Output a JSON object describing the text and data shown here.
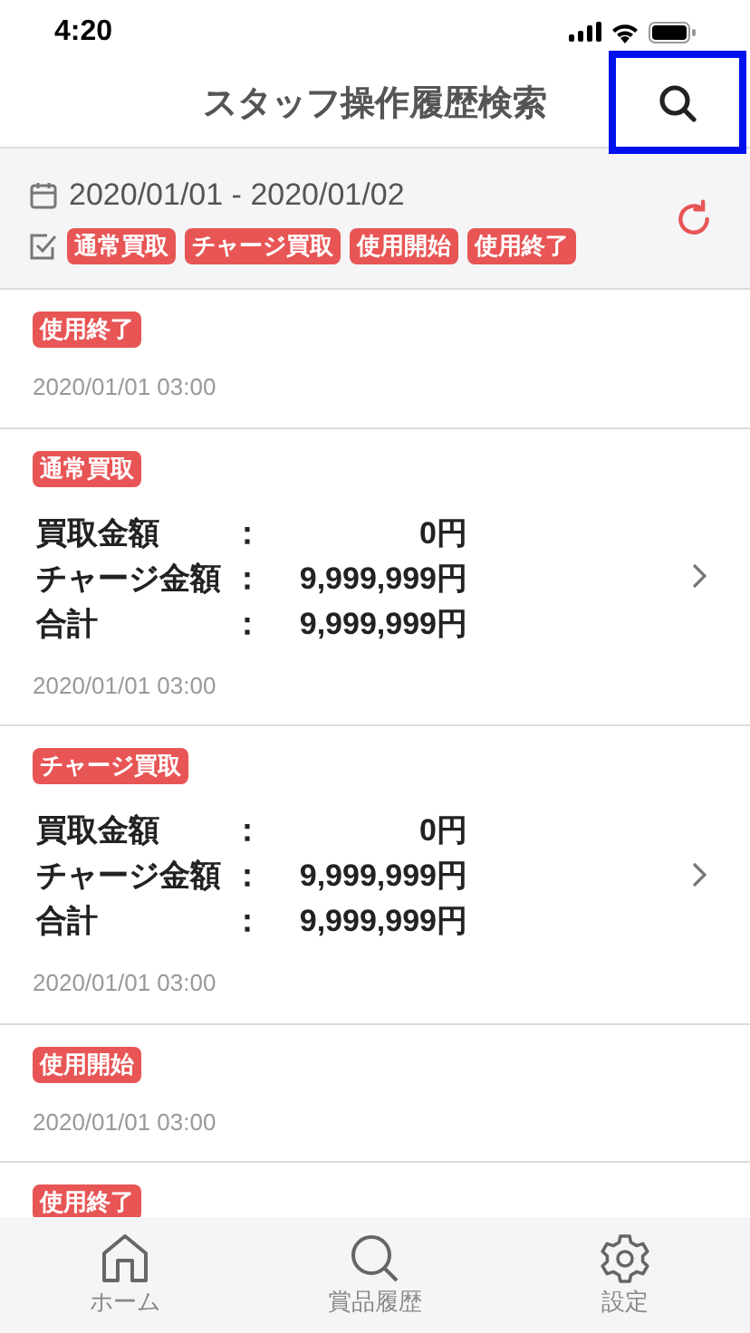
{
  "status_bar": {
    "time": "4:20"
  },
  "header": {
    "title": "スタッフ操作履歴検索",
    "search_highlighted": true
  },
  "filter": {
    "date_range": "2020/01/01 - 2020/01/02",
    "tags": [
      "通常買取",
      "チャージ買取",
      "使用開始",
      "使用終了"
    ]
  },
  "history": [
    {
      "kind": "simple",
      "tag": "使用終了",
      "time": "2020/01/01 03:00"
    },
    {
      "kind": "detail",
      "tag": "通常買取",
      "rows": [
        {
          "label": "買取金額",
          "colon": "：",
          "value": "0円"
        },
        {
          "label": "チャージ金額",
          "colon": "：",
          "value": "9,999,999円"
        },
        {
          "label": "合計",
          "colon": "：",
          "value": "9,999,999円"
        }
      ],
      "time": "2020/01/01 03:00"
    },
    {
      "kind": "detail",
      "tag": "チャージ買取",
      "rows": [
        {
          "label": "買取金額",
          "colon": "：",
          "value": "0円"
        },
        {
          "label": "チャージ金額",
          "colon": "：",
          "value": "9,999,999円"
        },
        {
          "label": "合計",
          "colon": "：",
          "value": "9,999,999円"
        }
      ],
      "time": "2020/01/01 03:00"
    },
    {
      "kind": "simple",
      "tag": "使用開始",
      "time": "2020/01/01 03:00"
    },
    {
      "kind": "simple",
      "tag": "使用終了"
    }
  ],
  "tab_bar": [
    {
      "kind": "home",
      "label": "ホーム"
    },
    {
      "kind": "search",
      "label": "賞品履歴"
    },
    {
      "kind": "settings",
      "label": "設定"
    }
  ]
}
